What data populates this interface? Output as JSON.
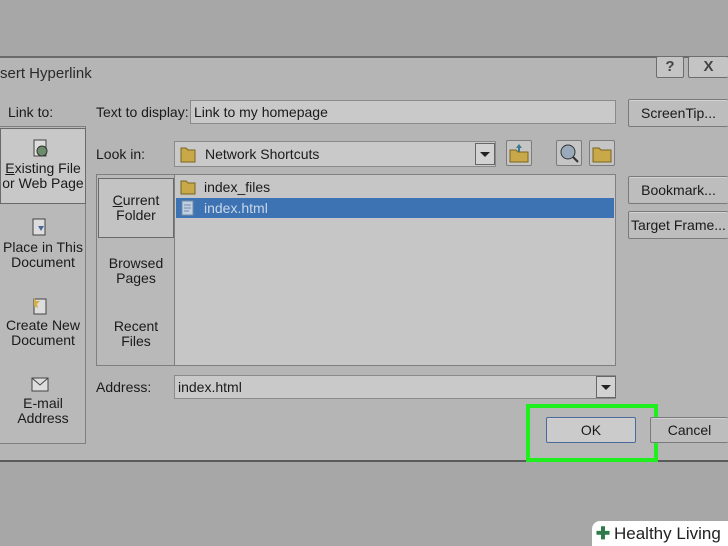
{
  "dialog": {
    "title": "sert Hyperlink",
    "help_label": "?",
    "close_label": "X"
  },
  "link_to": {
    "label": "Link to:",
    "items": [
      {
        "line1": "Existing File",
        "line2": "or Web Page",
        "selected": true
      },
      {
        "line1": "Place in This",
        "line2": "Document"
      },
      {
        "line1": "Create New",
        "line2": "Document"
      },
      {
        "line1": "E-mail",
        "line2": "Address"
      }
    ]
  },
  "text_to_display": {
    "label": "Text to display:",
    "value": "Link to my homepage"
  },
  "screentip_label": "ScreenTip...",
  "look_in": {
    "label": "Look in:",
    "value": "Network Shortcuts"
  },
  "tabs": [
    {
      "line1": "Current",
      "line2": "Folder",
      "selected": true
    },
    {
      "line1": "Browsed",
      "line2": "Pages"
    },
    {
      "line1": "Recent",
      "line2": "Files"
    }
  ],
  "files": [
    {
      "name": "index_files",
      "type": "folder"
    },
    {
      "name": "index.html",
      "type": "file",
      "selected": true
    }
  ],
  "bookmark_label": "Bookmark...",
  "target_frame_label": "Target Frame...",
  "address": {
    "label": "Address:",
    "value": "index.html"
  },
  "ok_label": "OK",
  "cancel_label": "Cancel",
  "watermark": "Healthy Living",
  "colors": {
    "highlight": "#1fee1f",
    "selection": "#3e73b3"
  }
}
